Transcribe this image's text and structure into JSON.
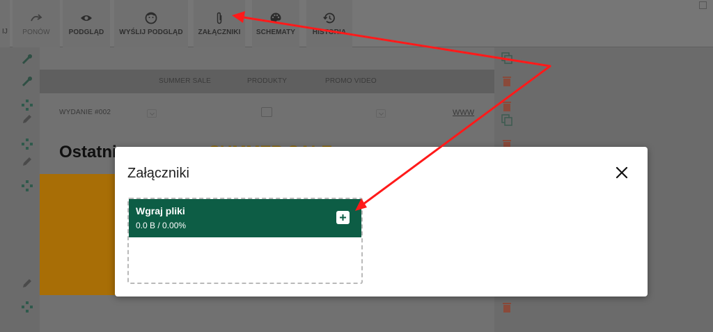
{
  "toolbar": {
    "items": [
      {
        "label": "IJ"
      },
      {
        "label": "PONÓW"
      },
      {
        "label": "PODGLĄD"
      },
      {
        "label": "WYŚLIJ PODGLĄD"
      },
      {
        "label": "ZAŁĄCZNIKI"
      },
      {
        "label": "SCHEMATY"
      },
      {
        "label": "HISTORIA"
      }
    ]
  },
  "canvas": {
    "nav_links": [
      "SUMMER SALE",
      "PRODUKTY",
      "PROMO VIDEO"
    ],
    "issue_label": "WYDANIE #002",
    "www_link": "WWW",
    "headline_start": "Ostatni",
    "headline_sale": "SUMMER SALE"
  },
  "modal": {
    "title": "Załączniki",
    "upload": {
      "title": "Wgraj pliki",
      "stats": "0.0 B / 0.00%"
    }
  },
  "colors": {
    "upload_bar": "#0d5d45",
    "annotation_arrow": "#ff1a1a",
    "orange_block": "#a86e06"
  },
  "icons": {
    "close": "close-icon",
    "add": "plus-icon",
    "attachments": "paperclip-icon"
  }
}
